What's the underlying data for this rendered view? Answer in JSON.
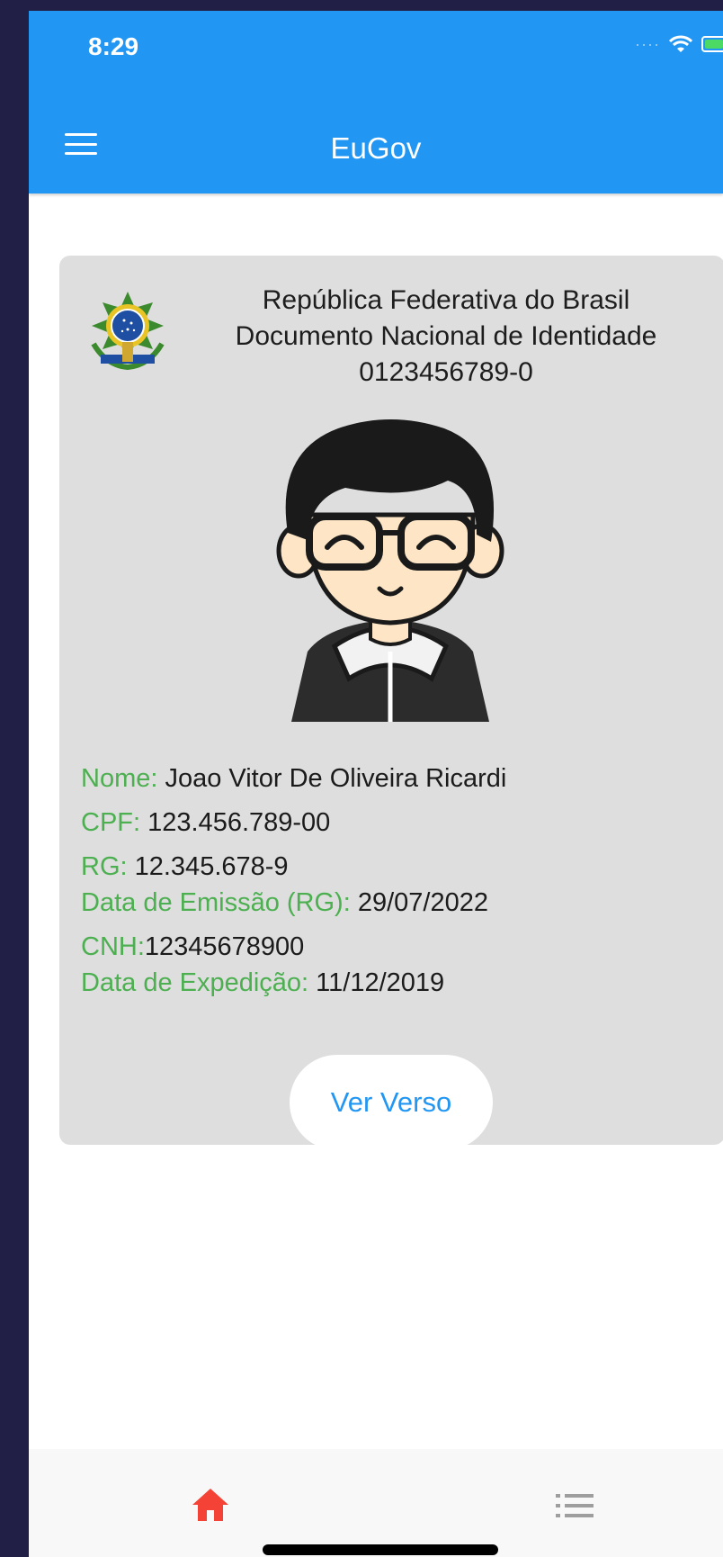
{
  "status_bar": {
    "time": "8:29"
  },
  "app_bar": {
    "title": "EuGov",
    "menu_icon": "hamburger-menu-icon"
  },
  "card": {
    "header_lines": [
      "República Federativa do Brasil",
      "Documento Nacional de Identidade",
      "0123456789-0"
    ],
    "fields": {
      "nome": {
        "label": "Nome:",
        "value": " Joao Vitor De Oliveira Ricardi"
      },
      "cpf": {
        "label": "CPF:",
        "value": " 123.456.789-00"
      },
      "rg": {
        "label": "RG:",
        "value": " 12.345.678-9"
      },
      "data_emissao": {
        "label": "Data de Emissão (RG):",
        "value": " 29/07/2022"
      },
      "cnh": {
        "label": "CNH:",
        "value": "12345678900"
      },
      "data_expedicao": {
        "label": "Data de Expedição:",
        "value": " 11/12/2019"
      }
    },
    "button_label": "Ver Verso"
  },
  "bottom_nav": {
    "active_icon": "home-icon",
    "other_icon": "list-icon"
  },
  "colors": {
    "primary": "#2196f3",
    "label_green": "#4caf50",
    "active_nav": "#f44336",
    "card_bg": "#dedede"
  }
}
